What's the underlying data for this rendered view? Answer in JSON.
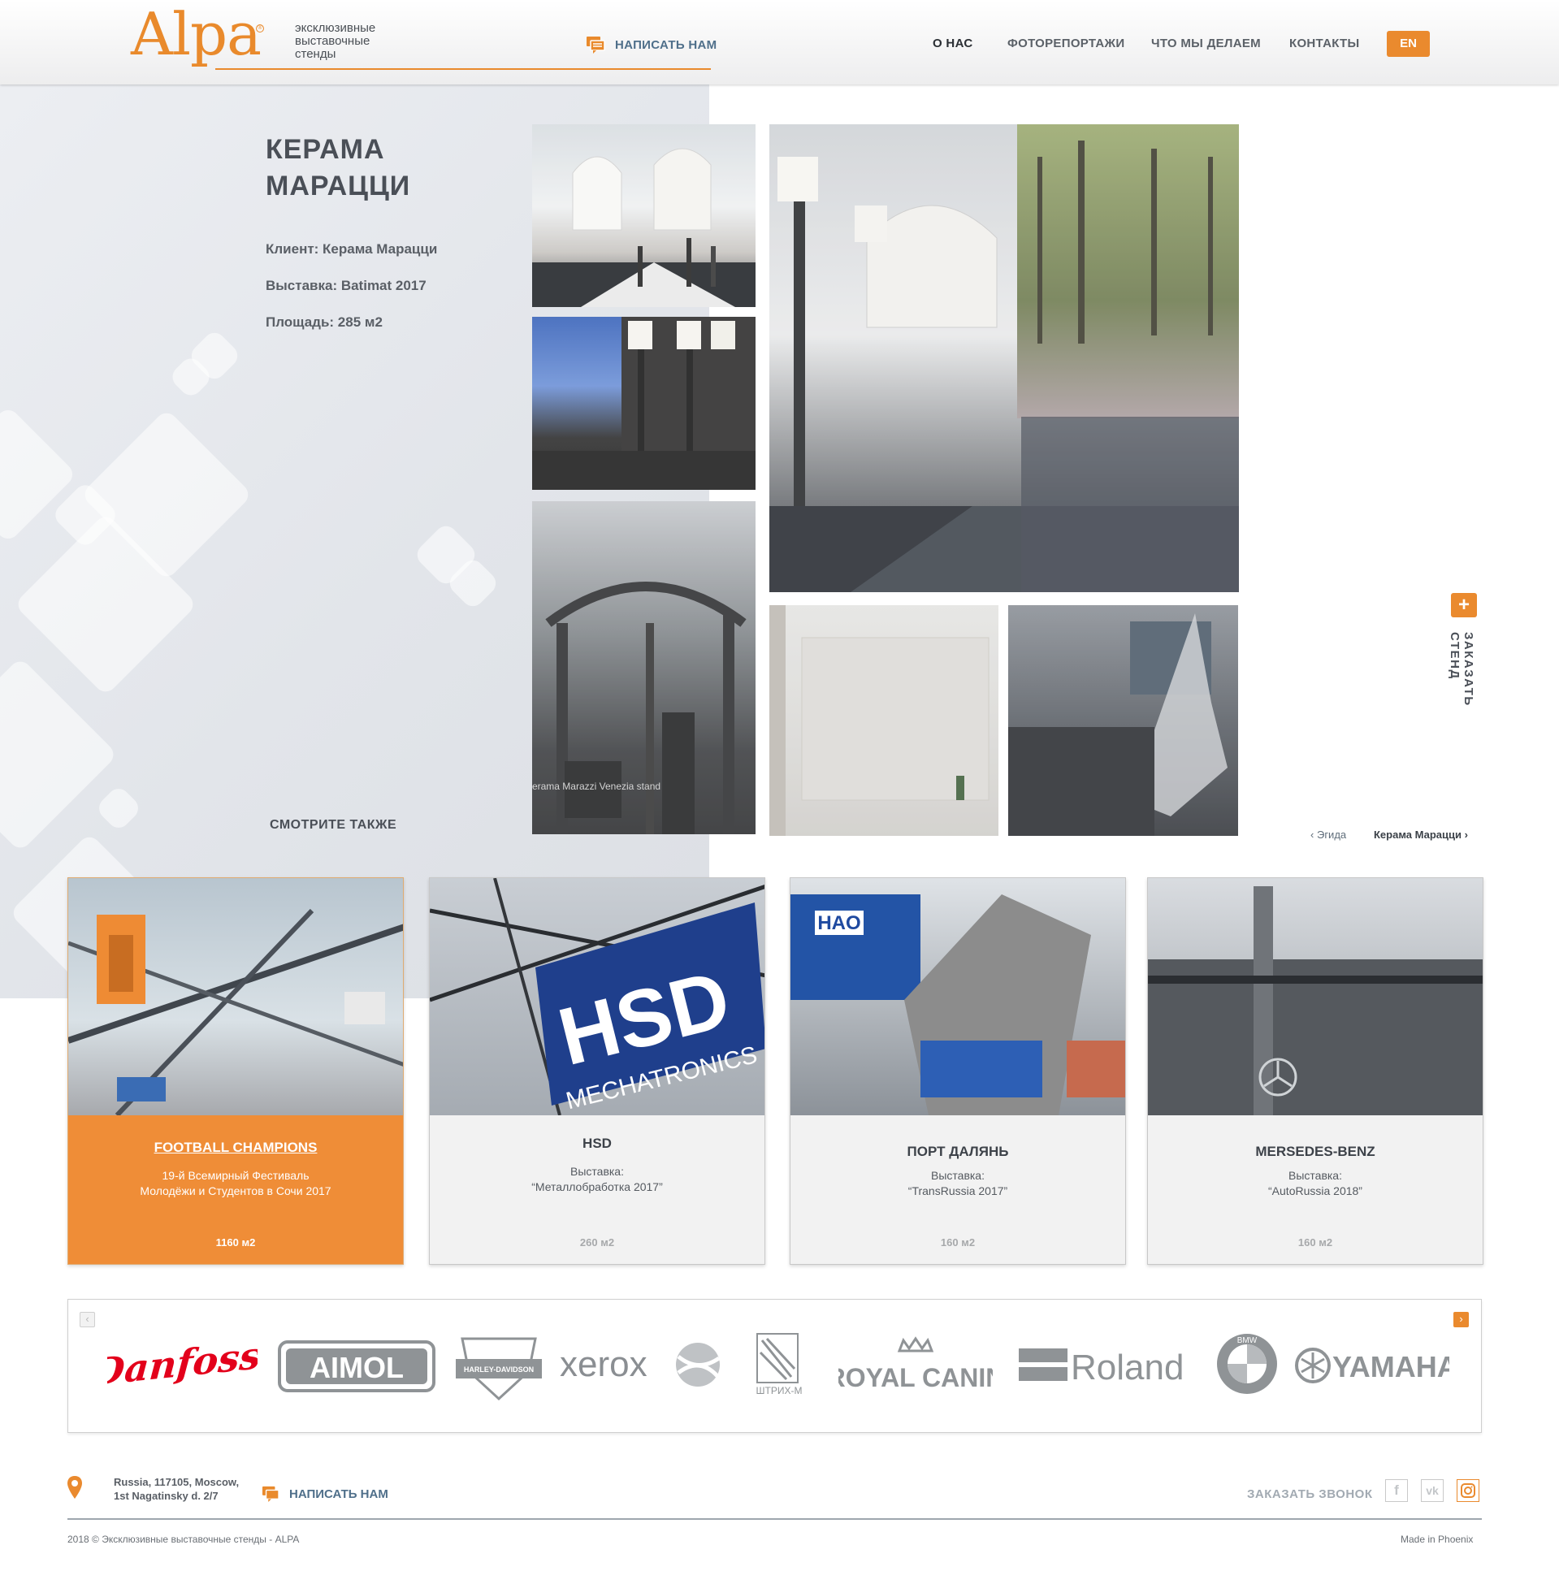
{
  "header": {
    "logo_text": "Alpa",
    "logo_reg": "®",
    "tagline": "эксклюзивные выставочные стенды",
    "write_us": "НАПИСАТЬ НАМ",
    "nav": [
      "О НАС",
      "ФОТОРЕПОРТАЖИ",
      "ЧТО МЫ ДЕЛАЕМ",
      "КОНТАКТЫ"
    ],
    "lang": "EN",
    "accent_color": "#ea8a2e"
  },
  "project": {
    "title": "КЕРАМА МАРАЦЦИ",
    "client": "Клиент: Керама Марацци",
    "exhibition": "Выставка: Batimat 2017",
    "area": "Площадь: 285 м2",
    "see_also": "СМОТРИТЕ ТАКЖЕ"
  },
  "photos": [
    {
      "label": "Kerama Marazzi Venezia stand"
    }
  ],
  "order": {
    "plus": "+",
    "text": "ЗАКАЗАТЬ СТЕНД"
  },
  "pager": {
    "prev": "Эгида",
    "next": "Керама Марацци",
    "prev_icon": "‹",
    "next_icon": "›"
  },
  "cards": [
    {
      "title": "FOOTBALL CHAMPIONS",
      "sub1": "19-й Всемирный Фестиваль",
      "sub2": "Молодёжи и Студентов в Сочи 2017",
      "area": "1160 м2"
    },
    {
      "title": "HSD",
      "sub1": "Выставка:",
      "sub2": "“Металлобработка 2017”",
      "area": "260 м2",
      "img_line1": "HSD",
      "img_line2": "MECHATRONICS"
    },
    {
      "title": "ПОРТ ДАЛЯНЬ",
      "sub1": "Выставка:",
      "sub2": "“TransRussia 2017”",
      "area": "160 м2",
      "img_text": "HAO"
    },
    {
      "title": "MERSEDES-BENZ",
      "sub1": "Выставка:",
      "sub2": "“AutoRussia 2018”",
      "area": "160 м2"
    }
  ],
  "brands": {
    "prev": "‹",
    "next": "›",
    "items": [
      "Danfoss",
      "AIMOL",
      "HARLEY-DAVIDSON",
      "xerox",
      "ШТРИХ-М",
      "ROYAL CANIN",
      "Roland",
      "BMW",
      "YAMAHA"
    ]
  },
  "footer": {
    "address_line1": "Russia, 117105, Moscow,",
    "address_line2": "1st Nagatinsky d. 2/7",
    "write_us": "НАПИСАТЬ НАМ",
    "callback": "ЗАКАЗАТЬ ЗВОНОК",
    "social": [
      "f",
      "vk"
    ],
    "copyright": "2018 © Эксклюзивные выставочные стенды - ALPA",
    "made_in": "Made in Phoenix"
  }
}
